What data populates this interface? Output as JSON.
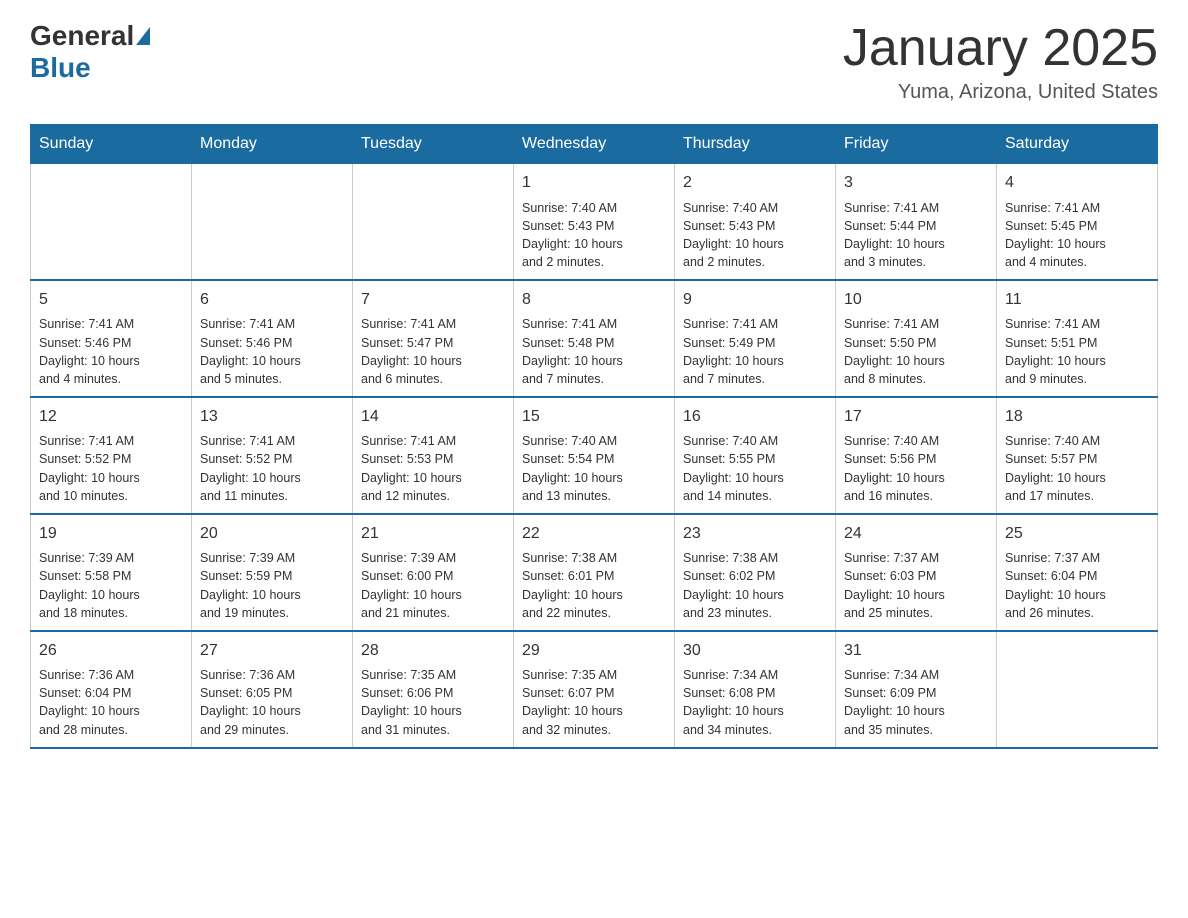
{
  "header": {
    "logo_general": "General",
    "logo_blue": "Blue",
    "month_title": "January 2025",
    "location": "Yuma, Arizona, United States"
  },
  "days_of_week": [
    "Sunday",
    "Monday",
    "Tuesday",
    "Wednesday",
    "Thursday",
    "Friday",
    "Saturday"
  ],
  "weeks": [
    [
      {
        "day": "",
        "info": ""
      },
      {
        "day": "",
        "info": ""
      },
      {
        "day": "",
        "info": ""
      },
      {
        "day": "1",
        "info": "Sunrise: 7:40 AM\nSunset: 5:43 PM\nDaylight: 10 hours\nand 2 minutes."
      },
      {
        "day": "2",
        "info": "Sunrise: 7:40 AM\nSunset: 5:43 PM\nDaylight: 10 hours\nand 2 minutes."
      },
      {
        "day": "3",
        "info": "Sunrise: 7:41 AM\nSunset: 5:44 PM\nDaylight: 10 hours\nand 3 minutes."
      },
      {
        "day": "4",
        "info": "Sunrise: 7:41 AM\nSunset: 5:45 PM\nDaylight: 10 hours\nand 4 minutes."
      }
    ],
    [
      {
        "day": "5",
        "info": "Sunrise: 7:41 AM\nSunset: 5:46 PM\nDaylight: 10 hours\nand 4 minutes."
      },
      {
        "day": "6",
        "info": "Sunrise: 7:41 AM\nSunset: 5:46 PM\nDaylight: 10 hours\nand 5 minutes."
      },
      {
        "day": "7",
        "info": "Sunrise: 7:41 AM\nSunset: 5:47 PM\nDaylight: 10 hours\nand 6 minutes."
      },
      {
        "day": "8",
        "info": "Sunrise: 7:41 AM\nSunset: 5:48 PM\nDaylight: 10 hours\nand 7 minutes."
      },
      {
        "day": "9",
        "info": "Sunrise: 7:41 AM\nSunset: 5:49 PM\nDaylight: 10 hours\nand 7 minutes."
      },
      {
        "day": "10",
        "info": "Sunrise: 7:41 AM\nSunset: 5:50 PM\nDaylight: 10 hours\nand 8 minutes."
      },
      {
        "day": "11",
        "info": "Sunrise: 7:41 AM\nSunset: 5:51 PM\nDaylight: 10 hours\nand 9 minutes."
      }
    ],
    [
      {
        "day": "12",
        "info": "Sunrise: 7:41 AM\nSunset: 5:52 PM\nDaylight: 10 hours\nand 10 minutes."
      },
      {
        "day": "13",
        "info": "Sunrise: 7:41 AM\nSunset: 5:52 PM\nDaylight: 10 hours\nand 11 minutes."
      },
      {
        "day": "14",
        "info": "Sunrise: 7:41 AM\nSunset: 5:53 PM\nDaylight: 10 hours\nand 12 minutes."
      },
      {
        "day": "15",
        "info": "Sunrise: 7:40 AM\nSunset: 5:54 PM\nDaylight: 10 hours\nand 13 minutes."
      },
      {
        "day": "16",
        "info": "Sunrise: 7:40 AM\nSunset: 5:55 PM\nDaylight: 10 hours\nand 14 minutes."
      },
      {
        "day": "17",
        "info": "Sunrise: 7:40 AM\nSunset: 5:56 PM\nDaylight: 10 hours\nand 16 minutes."
      },
      {
        "day": "18",
        "info": "Sunrise: 7:40 AM\nSunset: 5:57 PM\nDaylight: 10 hours\nand 17 minutes."
      }
    ],
    [
      {
        "day": "19",
        "info": "Sunrise: 7:39 AM\nSunset: 5:58 PM\nDaylight: 10 hours\nand 18 minutes."
      },
      {
        "day": "20",
        "info": "Sunrise: 7:39 AM\nSunset: 5:59 PM\nDaylight: 10 hours\nand 19 minutes."
      },
      {
        "day": "21",
        "info": "Sunrise: 7:39 AM\nSunset: 6:00 PM\nDaylight: 10 hours\nand 21 minutes."
      },
      {
        "day": "22",
        "info": "Sunrise: 7:38 AM\nSunset: 6:01 PM\nDaylight: 10 hours\nand 22 minutes."
      },
      {
        "day": "23",
        "info": "Sunrise: 7:38 AM\nSunset: 6:02 PM\nDaylight: 10 hours\nand 23 minutes."
      },
      {
        "day": "24",
        "info": "Sunrise: 7:37 AM\nSunset: 6:03 PM\nDaylight: 10 hours\nand 25 minutes."
      },
      {
        "day": "25",
        "info": "Sunrise: 7:37 AM\nSunset: 6:04 PM\nDaylight: 10 hours\nand 26 minutes."
      }
    ],
    [
      {
        "day": "26",
        "info": "Sunrise: 7:36 AM\nSunset: 6:04 PM\nDaylight: 10 hours\nand 28 minutes."
      },
      {
        "day": "27",
        "info": "Sunrise: 7:36 AM\nSunset: 6:05 PM\nDaylight: 10 hours\nand 29 minutes."
      },
      {
        "day": "28",
        "info": "Sunrise: 7:35 AM\nSunset: 6:06 PM\nDaylight: 10 hours\nand 31 minutes."
      },
      {
        "day": "29",
        "info": "Sunrise: 7:35 AM\nSunset: 6:07 PM\nDaylight: 10 hours\nand 32 minutes."
      },
      {
        "day": "30",
        "info": "Sunrise: 7:34 AM\nSunset: 6:08 PM\nDaylight: 10 hours\nand 34 minutes."
      },
      {
        "day": "31",
        "info": "Sunrise: 7:34 AM\nSunset: 6:09 PM\nDaylight: 10 hours\nand 35 minutes."
      },
      {
        "day": "",
        "info": ""
      }
    ]
  ]
}
